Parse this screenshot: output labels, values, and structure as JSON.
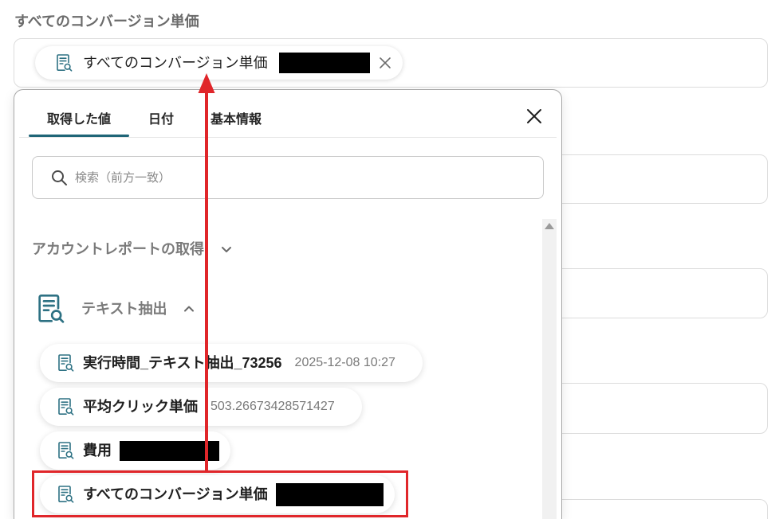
{
  "field": {
    "label": "すべてのコンバージョン単価",
    "selected_chip": {
      "icon": "document-search-icon",
      "label": "すべてのコンバージョン単価",
      "value_redacted": true,
      "remove_icon": "close-icon"
    }
  },
  "picker": {
    "tabs": [
      {
        "label": "取得した値",
        "active": true
      },
      {
        "label": "日付",
        "active": false
      },
      {
        "label": "基本情報",
        "active": false
      }
    ],
    "close_icon": "close-icon",
    "search": {
      "icon": "search-icon",
      "placeholder": "検索（前方一致）"
    },
    "sections": [
      {
        "title": "アカウントレポートの取得",
        "expanded": false,
        "toggle_icon": "chevron-down-icon"
      },
      {
        "title": "テキスト抽出",
        "expanded": true,
        "icon": "document-search-icon",
        "toggle_icon": "chevron-up-icon",
        "items": [
          {
            "icon": "document-search-icon",
            "label": "実行時間_テキスト抽出_73256",
            "value": "2025-12-08 10:27"
          },
          {
            "icon": "document-search-icon",
            "label": "平均クリック単価",
            "value": "503.26673428571427"
          },
          {
            "icon": "document-search-icon",
            "label": "費用",
            "value_redacted": true
          },
          {
            "icon": "document-search-icon",
            "label": "すべてのコンバージョン単価",
            "value_redacted": true,
            "highlighted": true
          }
        ]
      }
    ]
  },
  "colors": {
    "accent": "#1f6577",
    "icon": "#2d7183",
    "annotation": "#e0262a",
    "text": "#1f1f1f",
    "muted": "#7a7a7a"
  }
}
